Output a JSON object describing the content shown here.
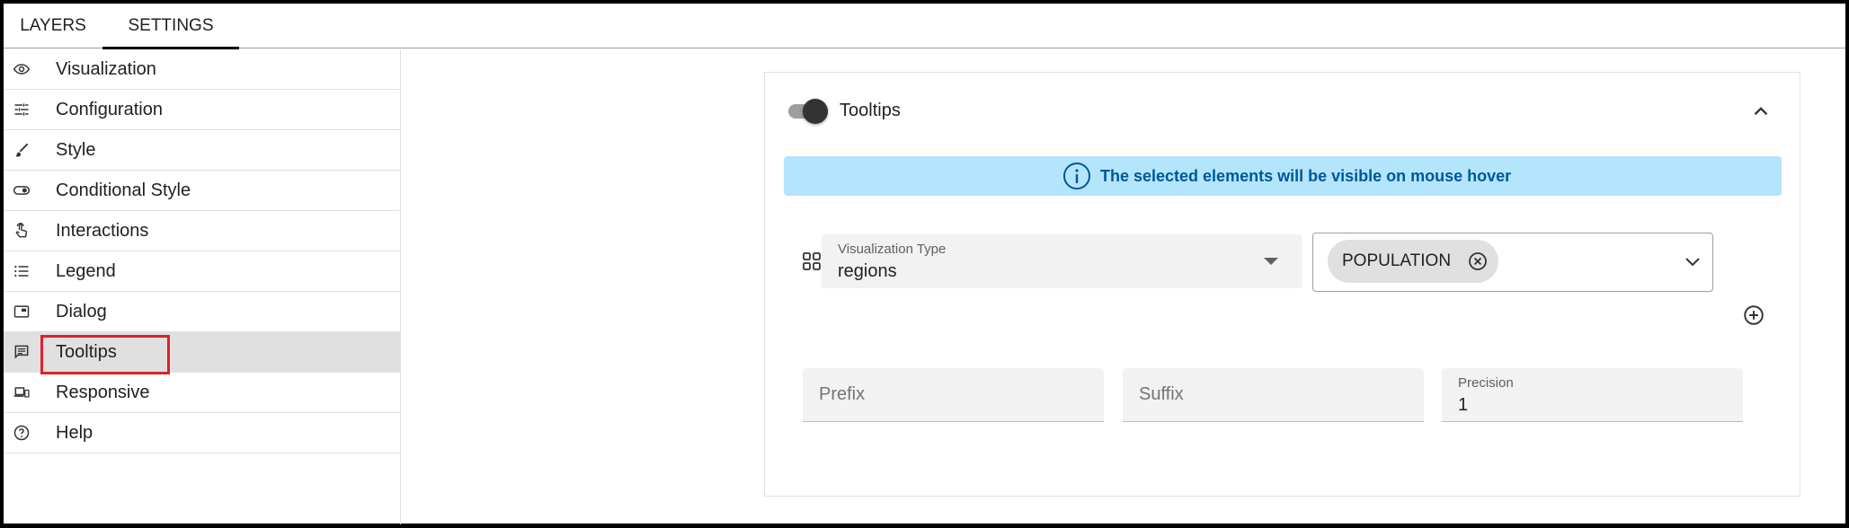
{
  "tabs": {
    "layers": "LAYERS",
    "settings": "SETTINGS"
  },
  "sidebar": {
    "items": [
      {
        "label": "Visualization",
        "icon": "eye-icon"
      },
      {
        "label": "Configuration",
        "icon": "tune-icon"
      },
      {
        "label": "Style",
        "icon": "brush-icon"
      },
      {
        "label": "Conditional Style",
        "icon": "toggle-icon"
      },
      {
        "label": "Interactions",
        "icon": "touch-icon"
      },
      {
        "label": "Legend",
        "icon": "list-icon"
      },
      {
        "label": "Dialog",
        "icon": "dialog-icon"
      },
      {
        "label": "Tooltips",
        "icon": "comment-icon",
        "active": true
      },
      {
        "label": "Responsive",
        "icon": "devices-icon"
      },
      {
        "label": "Help",
        "icon": "help-icon"
      }
    ]
  },
  "panel": {
    "title": "Tooltips",
    "enabled": true,
    "info": "The selected elements will be visible on mouse hover",
    "visualization_type": {
      "label": "Visualization Type",
      "value": "regions"
    },
    "fields": {
      "chips": [
        "POPULATION"
      ]
    },
    "prefix": {
      "placeholder": "Prefix"
    },
    "suffix": {
      "placeholder": "Suffix"
    },
    "precision": {
      "label": "Precision",
      "value": "1"
    }
  },
  "colors": {
    "info_bg": "#b3e5fc",
    "info_text": "#01579b",
    "active_item": "#e0e0e0",
    "highlight": "#e0202a"
  }
}
